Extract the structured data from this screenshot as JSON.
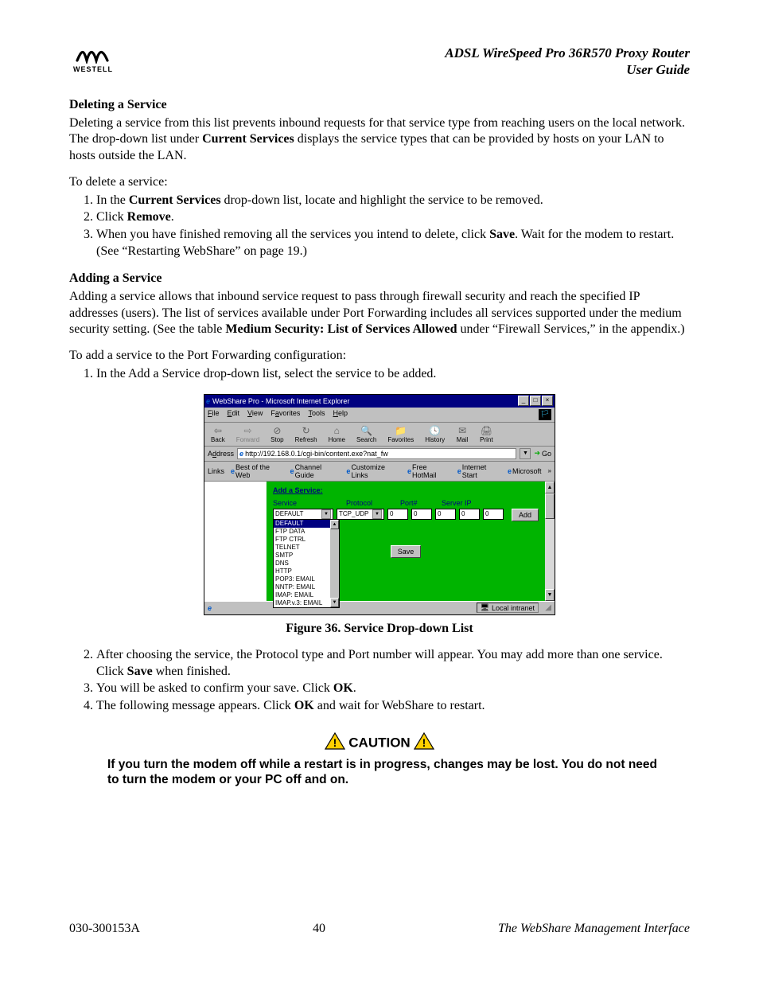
{
  "header": {
    "logo_text": "WESTELL",
    "title_line1": "ADSL WireSpeed Pro 36R570 Proxy Router",
    "title_line2": "User Guide"
  },
  "sec1": {
    "heading": "Deleting a Service",
    "p1a": " Deleting a service from this list prevents inbound requests for that service type from reaching users on the local network. The drop-down list under ",
    "p1b": "Current Services",
    "p1c": " displays the service types that can be provided by hosts on your LAN to hosts outside the LAN.",
    "p2": "To delete a service:",
    "l1a": "In the ",
    "l1b": "Current Services",
    "l1c": " drop-down list, locate and highlight the service to be removed.",
    "l2a": "Click ",
    "l2b": "Remove",
    "l2c": ".",
    "l3a": "When you have finished removing all the services you intend to delete, click ",
    "l3b": "Save",
    "l3c": ". Wait for the modem to restart. (See “Restarting WebShare” on page 19.)"
  },
  "sec2": {
    "heading": "Adding a Service",
    "p1a": "Adding a service allows that inbound service request to pass through firewall security and reach the specified IP addresses (users). The list of services available under Port Forwarding includes all services supported under the medium security setting. (See the table ",
    "p1b": "Medium Security: List of Services Allowed",
    "p1c": " under “Firewall Services,” in the appendix.)",
    "p2": "To add a service to the Port Forwarding configuration:",
    "l1": "In the Add a Service drop-down list, select the service to be added."
  },
  "screenshot": {
    "window_title": "WebShare Pro - Microsoft Internet Explorer",
    "menu": {
      "file": "File",
      "edit": "Edit",
      "view": "View",
      "favorites": "Favorites",
      "tools": "Tools",
      "help": "Help"
    },
    "toolbar": {
      "back": "Back",
      "forward": "Forward",
      "stop": "Stop",
      "refresh": "Refresh",
      "home": "Home",
      "search": "Search",
      "favorites": "Favorites",
      "history": "History",
      "mail": "Mail",
      "print": "Print"
    },
    "address_label": "Address",
    "address_url": "http://192.168.0.1/cgi-bin/content.exe?nat_fw",
    "go": "Go",
    "links_label": "Links",
    "links": {
      "best": "Best of the Web",
      "channel": "Channel Guide",
      "customize": "Customize Links",
      "hotmail": "Free HotMail",
      "istart": "Internet Start",
      "ms": "Microsoft"
    },
    "panel_title": "Add a Service:",
    "col_service": "Service",
    "col_protocol": "Protocol",
    "col_port": "Port#",
    "col_server": "Server IP",
    "service_selected": "DEFAULT",
    "service_options": [
      "DEFAULT",
      "FTP DATA",
      "FTP CTRL",
      "TELNET",
      "SMTP",
      "DNS",
      "HTTP",
      "POP3: EMAIL",
      "NNTP: EMAIL",
      "IMAP: EMAIL",
      "IMAP.v.3: EMAIL"
    ],
    "protocol": "TCP_UDP",
    "port": "0",
    "ip1": "0",
    "ip2": "0",
    "ip3": "0",
    "ip4": "0",
    "add_btn": "Add",
    "save_btn": "Save",
    "status_zone": "Local intranet"
  },
  "figure_caption": "Figure 36. Service Drop-down List",
  "sec3": {
    "l2a": "After choosing the service, the Protocol type and Port number will appear. You may add more than one service. Click ",
    "l2b": "Save",
    "l2c": " when finished.",
    "l3a": "You will be asked to confirm your save. Click ",
    "l3b": "OK",
    "l3c": ".",
    "l4a": "The following message appears. Click ",
    "l4b": "OK",
    "l4c": " and wait for WebShare to restart."
  },
  "caution": {
    "label": "CAUTION",
    "text": "If you turn the modem off while a restart is in progress, changes may be lost. You do not need to turn the modem or your PC off and on."
  },
  "footer": {
    "left": "030-300153A",
    "center": "40",
    "right": "The WebShare Management Interface"
  }
}
